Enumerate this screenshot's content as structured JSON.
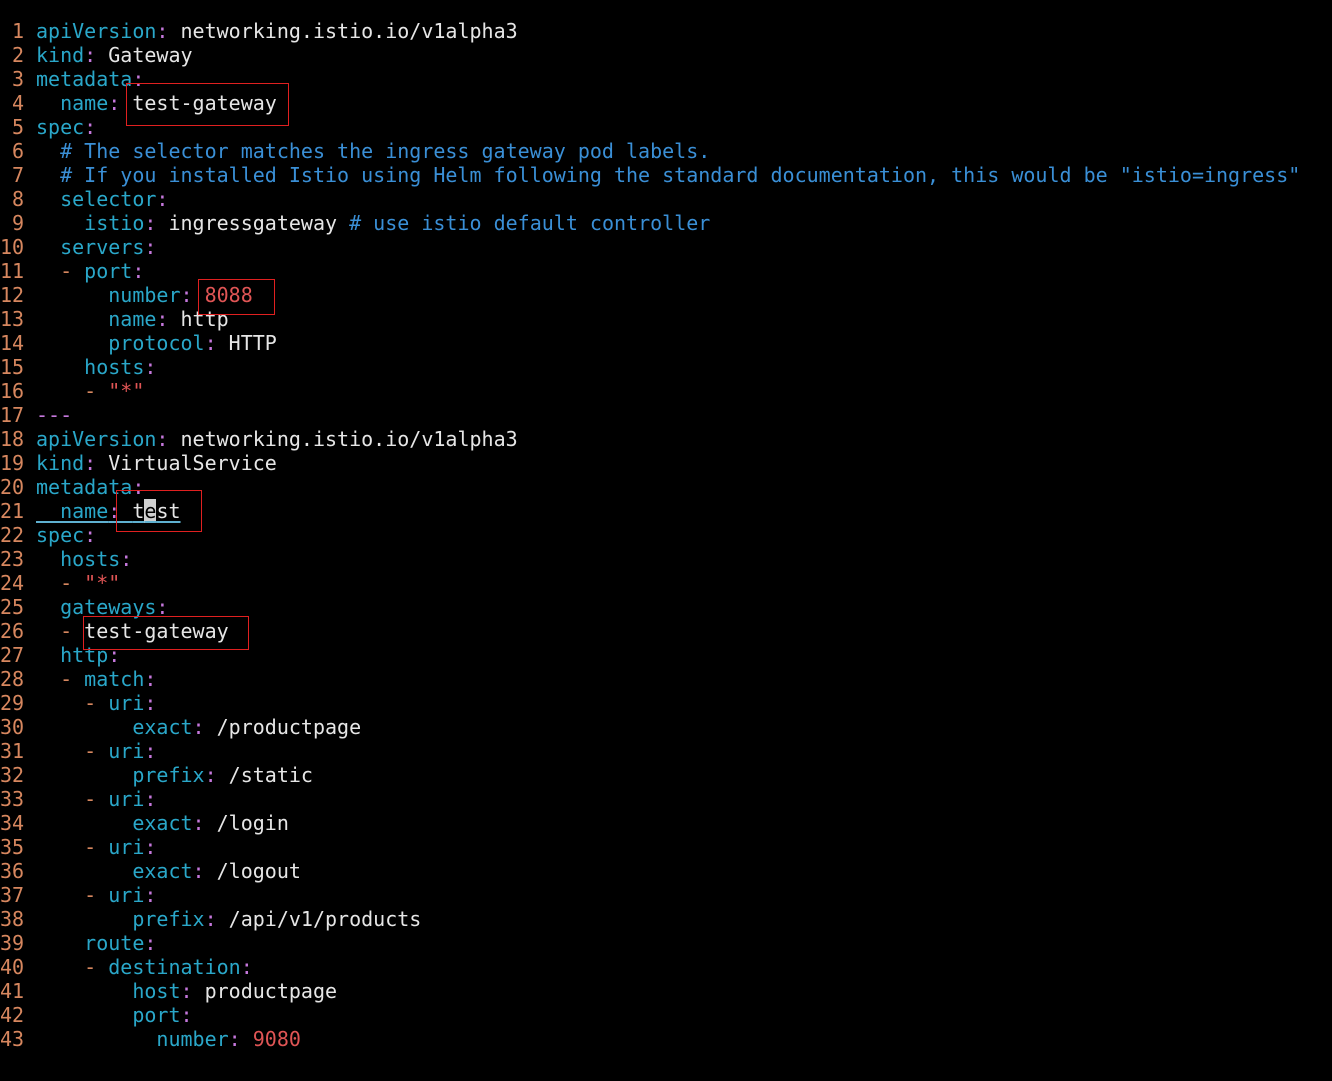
{
  "editor": {
    "lines": [
      {
        "no": "1",
        "parts": [
          [
            "apiVersion",
            "key"
          ],
          [
            ": ",
            "punc"
          ],
          [
            "networking.istio.io/v1alpha3",
            "val"
          ]
        ]
      },
      {
        "no": "2",
        "parts": [
          [
            "kind",
            "key"
          ],
          [
            ": ",
            "punc"
          ],
          [
            "Gateway",
            "val"
          ]
        ]
      },
      {
        "no": "3",
        "parts": [
          [
            "metadata",
            "key"
          ],
          [
            ":",
            "punc"
          ]
        ]
      },
      {
        "no": "4",
        "parts": [
          [
            "  name",
            "key"
          ],
          [
            ": ",
            "punc"
          ],
          [
            "test-gateway",
            "val"
          ]
        ]
      },
      {
        "no": "5",
        "parts": [
          [
            "spec",
            "key"
          ],
          [
            ":",
            "punc"
          ]
        ]
      },
      {
        "no": "6",
        "parts": [
          [
            "  # The selector matches the ingress gateway pod labels.",
            "com"
          ]
        ]
      },
      {
        "no": "7",
        "parts": [
          [
            "  # If you installed Istio using Helm following the standard documentation, this would be \"istio=ingress\"",
            "com"
          ]
        ]
      },
      {
        "no": "8",
        "parts": [
          [
            "  selector",
            "key"
          ],
          [
            ":",
            "punc"
          ]
        ]
      },
      {
        "no": "9",
        "parts": [
          [
            "    istio",
            "key"
          ],
          [
            ": ",
            "punc"
          ],
          [
            "ingressgateway ",
            "val"
          ],
          [
            "# use istio default controller",
            "com"
          ]
        ]
      },
      {
        "no": "10",
        "parts": [
          [
            "  servers",
            "key"
          ],
          [
            ":",
            "punc"
          ]
        ]
      },
      {
        "no": "11",
        "parts": [
          [
            "  - ",
            "dash"
          ],
          [
            "port",
            "key"
          ],
          [
            ":",
            "punc"
          ]
        ]
      },
      {
        "no": "12",
        "parts": [
          [
            "      number",
            "key"
          ],
          [
            ": ",
            "punc"
          ],
          [
            "8088",
            "num"
          ]
        ]
      },
      {
        "no": "13",
        "parts": [
          [
            "      name",
            "key"
          ],
          [
            ": ",
            "punc"
          ],
          [
            "http",
            "val"
          ]
        ]
      },
      {
        "no": "14",
        "parts": [
          [
            "      protocol",
            "key"
          ],
          [
            ": ",
            "punc"
          ],
          [
            "HTTP",
            "val"
          ]
        ]
      },
      {
        "no": "15",
        "parts": [
          [
            "    hosts",
            "key"
          ],
          [
            ":",
            "punc"
          ]
        ]
      },
      {
        "no": "16",
        "parts": [
          [
            "    - ",
            "dash"
          ],
          [
            "\"*\"",
            "str"
          ]
        ]
      },
      {
        "no": "17",
        "parts": [
          [
            "---",
            "sep"
          ]
        ]
      },
      {
        "no": "18",
        "parts": [
          [
            "apiVersion",
            "key"
          ],
          [
            ": ",
            "punc"
          ],
          [
            "networking.istio.io/v1alpha3",
            "val"
          ]
        ]
      },
      {
        "no": "19",
        "parts": [
          [
            "kind",
            "key"
          ],
          [
            ": ",
            "punc"
          ],
          [
            "VirtualService",
            "val"
          ]
        ]
      },
      {
        "no": "20",
        "parts": [
          [
            "metadata",
            "key"
          ],
          [
            ":",
            "punc"
          ]
        ]
      },
      {
        "no": "21",
        "parts": [
          [
            "  name",
            "key"
          ],
          [
            ": ",
            "punc"
          ],
          [
            "t",
            "val"
          ],
          [
            "e",
            "cursor"
          ],
          [
            "st",
            "val"
          ]
        ],
        "underline": true
      },
      {
        "no": "22",
        "parts": [
          [
            "spec",
            "key"
          ],
          [
            ":",
            "punc"
          ]
        ]
      },
      {
        "no": "23",
        "parts": [
          [
            "  hosts",
            "key"
          ],
          [
            ":",
            "punc"
          ]
        ]
      },
      {
        "no": "24",
        "parts": [
          [
            "  - ",
            "dash"
          ],
          [
            "\"*\"",
            "str"
          ]
        ]
      },
      {
        "no": "25",
        "parts": [
          [
            "  gateways",
            "key"
          ],
          [
            ":",
            "punc"
          ]
        ]
      },
      {
        "no": "26",
        "parts": [
          [
            "  - ",
            "dash"
          ],
          [
            "test-gateway",
            "val"
          ]
        ]
      },
      {
        "no": "27",
        "parts": [
          [
            "  http",
            "key"
          ],
          [
            ":",
            "punc"
          ]
        ]
      },
      {
        "no": "28",
        "parts": [
          [
            "  - ",
            "dash"
          ],
          [
            "match",
            "key"
          ],
          [
            ":",
            "punc"
          ]
        ]
      },
      {
        "no": "29",
        "parts": [
          [
            "    - ",
            "dash"
          ],
          [
            "uri",
            "key"
          ],
          [
            ":",
            "punc"
          ]
        ]
      },
      {
        "no": "30",
        "parts": [
          [
            "        exact",
            "key"
          ],
          [
            ": ",
            "punc"
          ],
          [
            "/productpage",
            "val"
          ]
        ]
      },
      {
        "no": "31",
        "parts": [
          [
            "    - ",
            "dash"
          ],
          [
            "uri",
            "key"
          ],
          [
            ":",
            "punc"
          ]
        ]
      },
      {
        "no": "32",
        "parts": [
          [
            "        prefix",
            "key"
          ],
          [
            ": ",
            "punc"
          ],
          [
            "/static",
            "val"
          ]
        ]
      },
      {
        "no": "33",
        "parts": [
          [
            "    - ",
            "dash"
          ],
          [
            "uri",
            "key"
          ],
          [
            ":",
            "punc"
          ]
        ]
      },
      {
        "no": "34",
        "parts": [
          [
            "        exact",
            "key"
          ],
          [
            ": ",
            "punc"
          ],
          [
            "/login",
            "val"
          ]
        ]
      },
      {
        "no": "35",
        "parts": [
          [
            "    - ",
            "dash"
          ],
          [
            "uri",
            "key"
          ],
          [
            ":",
            "punc"
          ]
        ]
      },
      {
        "no": "36",
        "parts": [
          [
            "        exact",
            "key"
          ],
          [
            ": ",
            "punc"
          ],
          [
            "/logout",
            "val"
          ]
        ]
      },
      {
        "no": "37",
        "parts": [
          [
            "    - ",
            "dash"
          ],
          [
            "uri",
            "key"
          ],
          [
            ":",
            "punc"
          ]
        ]
      },
      {
        "no": "38",
        "parts": [
          [
            "        prefix",
            "key"
          ],
          [
            ": ",
            "punc"
          ],
          [
            "/api/v1/products",
            "val"
          ]
        ]
      },
      {
        "no": "39",
        "parts": [
          [
            "    route",
            "key"
          ],
          [
            ":",
            "punc"
          ]
        ]
      },
      {
        "no": "40",
        "parts": [
          [
            "    - ",
            "dash"
          ],
          [
            "destination",
            "key"
          ],
          [
            ":",
            "punc"
          ]
        ]
      },
      {
        "no": "41",
        "parts": [
          [
            "        host",
            "key"
          ],
          [
            ": ",
            "punc"
          ],
          [
            "productpage",
            "val"
          ]
        ]
      },
      {
        "no": "42",
        "parts": [
          [
            "        port",
            "key"
          ],
          [
            ":",
            "punc"
          ]
        ]
      },
      {
        "no": "43",
        "parts": [
          [
            "          number",
            "key"
          ],
          [
            ": ",
            "punc"
          ],
          [
            "9080",
            "num"
          ]
        ]
      }
    ]
  },
  "colors": {
    "background": "#000000",
    "line_number": "#d7875f",
    "key": "#2aa7c9",
    "value": "#e6e6e6",
    "number": "#e05555",
    "comment": "#3a8fd6",
    "annotation_box": "#e02020"
  }
}
